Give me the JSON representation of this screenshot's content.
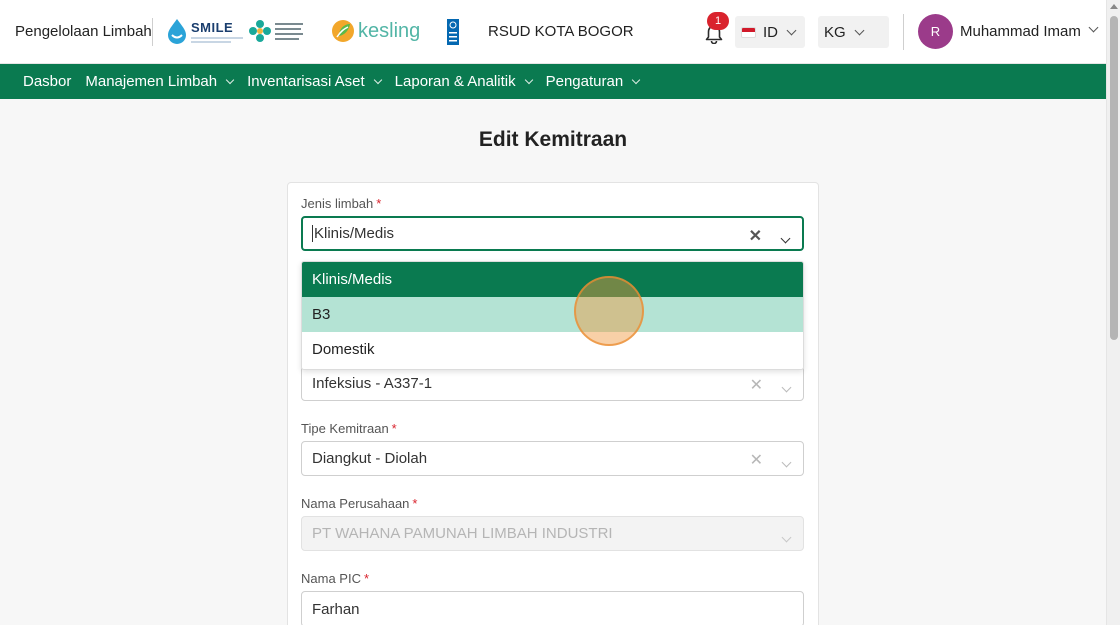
{
  "header": {
    "app_name": "Pengelolaan Limbah",
    "logos": [
      "SMILE",
      "kesling"
    ],
    "hospital": "RSUD KOTA BOGOR",
    "notification_count": "1",
    "language": "ID",
    "unit": "KG",
    "user_initial": "R",
    "user_name": "Muhammad Imam"
  },
  "nav": {
    "items": [
      {
        "label": "Dasbor",
        "has_dropdown": false
      },
      {
        "label": "Manajemen Limbah",
        "has_dropdown": true
      },
      {
        "label": "Inventarisasi Aset",
        "has_dropdown": true
      },
      {
        "label": "Laporan & Analitik",
        "has_dropdown": true
      },
      {
        "label": "Pengaturan",
        "has_dropdown": true
      }
    ]
  },
  "page": {
    "title": "Edit Kemitraan"
  },
  "form": {
    "jenis_limbah": {
      "label": "Jenis limbah",
      "value": "Klinis/Medis"
    },
    "jenis_options": [
      "Klinis/Medis",
      "B3",
      "Domestik"
    ],
    "kategori": {
      "value": "Infeksius - A337-1"
    },
    "tipe_kemitraan": {
      "label": "Tipe Kemitraan",
      "value": "Diangkut - Diolah"
    },
    "nama_perusahaan": {
      "label": "Nama Perusahaan",
      "value": "PT WAHANA PAMUNAH LIMBAH INDUSTRI"
    },
    "nama_pic": {
      "label": "Nama PIC",
      "value": "Farhan"
    },
    "required_mark": "*"
  },
  "colors": {
    "brand_green": "#0a7a50",
    "hover_option": "#b4e3d4",
    "badge_red": "#d9232d",
    "avatar": "#9b3b8a"
  }
}
